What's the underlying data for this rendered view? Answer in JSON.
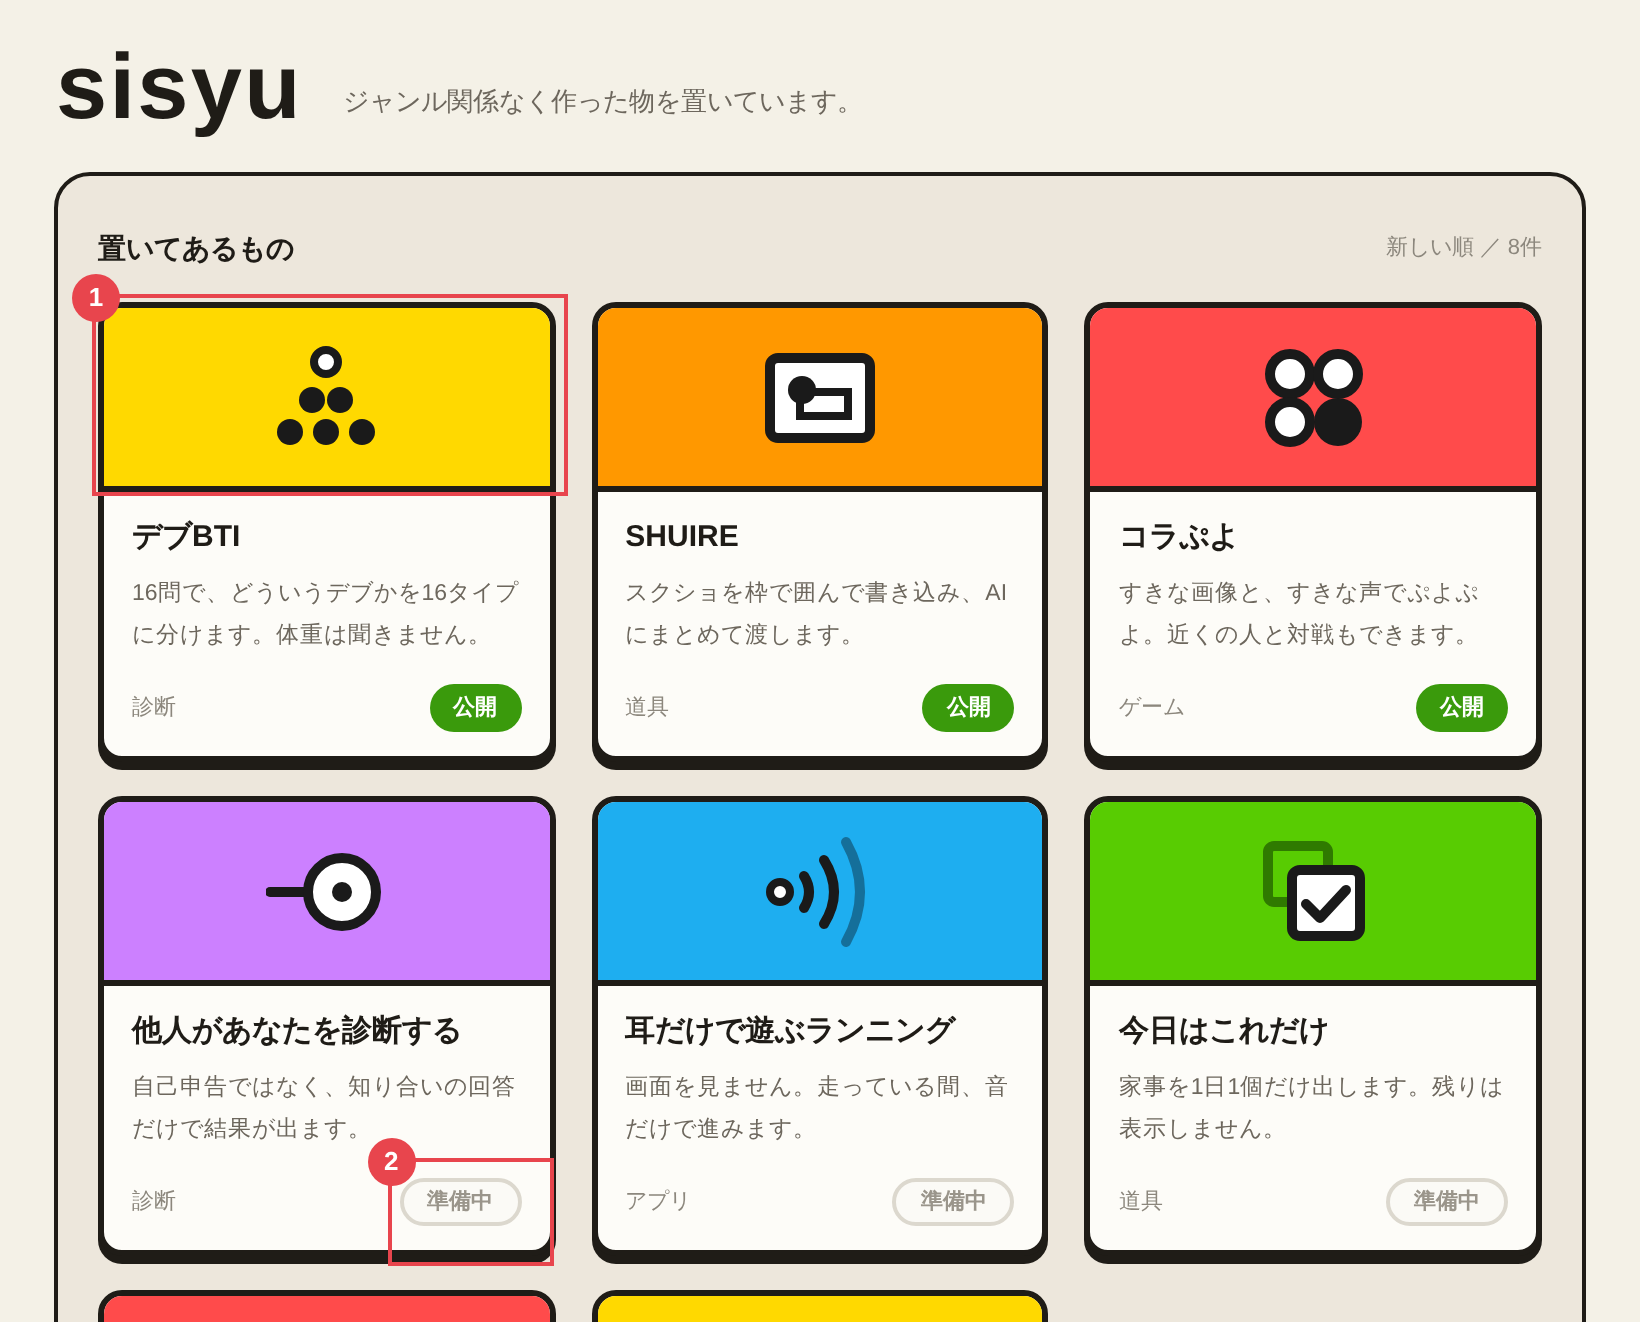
{
  "header": {
    "logo": "sisyu",
    "tagline": "ジャンル関係なく作った物を置いています。"
  },
  "section": {
    "title": "置いてあるもの",
    "meta": "新しい順 ／ 8件"
  },
  "cards": [
    {
      "title": "デブBTI",
      "description": "16問で、どういうデブかを16タイプに分けます。体重は聞きません。",
      "category": "診断",
      "status": {
        "text": "公開",
        "kind": "published"
      },
      "color": "#ffd900",
      "annotation": {
        "label": "1",
        "kind": "header"
      }
    },
    {
      "title": "SHUIRE",
      "description": "スクショを枠で囲んで書き込み、AIにまとめて渡します。",
      "category": "道具",
      "status": {
        "text": "公開",
        "kind": "published"
      },
      "color": "#ff9800"
    },
    {
      "title": "コラぷよ",
      "description": "すきな画像と、すきな声でぷよぷよ。近くの人と対戦もできます。",
      "category": "ゲーム",
      "status": {
        "text": "公開",
        "kind": "published"
      },
      "color": "#ff4b4b"
    },
    {
      "title": "他人があなたを診断する",
      "description": "自己申告ではなく、知り合いの回答だけで結果が出ます。",
      "category": "診断",
      "status": {
        "text": "準備中",
        "kind": "preparing"
      },
      "color": "#cc80ff",
      "annotation": {
        "label": "2",
        "kind": "badge"
      }
    },
    {
      "title": "耳だけで遊ぶランニング",
      "description": "画面を見ません。走っている間、音だけで進みます。",
      "category": "アプリ",
      "status": {
        "text": "準備中",
        "kind": "preparing"
      },
      "color": "#1eaef0"
    },
    {
      "title": "今日はこれだけ",
      "description": "家事を1日1個だけ出します。残りは表示しません。",
      "category": "道具",
      "status": {
        "text": "準備中",
        "kind": "preparing"
      },
      "color": "#58cc02"
    }
  ],
  "partial_cards": [
    {
      "color": "#ff4b4b"
    },
    {
      "color": "#ffd900"
    }
  ]
}
